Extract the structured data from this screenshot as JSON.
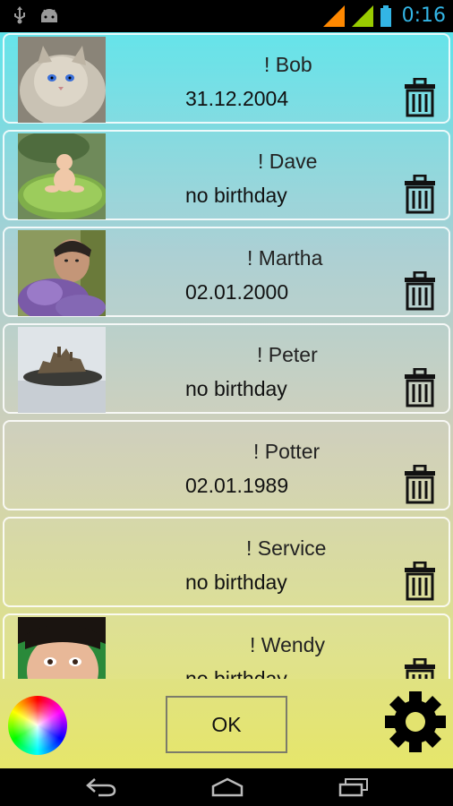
{
  "status": {
    "time": "0:16",
    "icons": [
      "usb-icon",
      "android-icon",
      "signal-orange-icon",
      "signal-green-icon",
      "battery-icon"
    ],
    "colors": {
      "time": "#33b5e5",
      "battery": "#33b5e5",
      "signal1": "#ff8800",
      "signal2": "#99cc00"
    }
  },
  "contacts": [
    {
      "name": "! Bob",
      "birthday": "31.12.2004",
      "photo": "kitten"
    },
    {
      "name": "! Dave",
      "birthday": "no birthday",
      "photo": "baby-on-leaf"
    },
    {
      "name": "! Martha",
      "birthday": "02.01.2000",
      "photo": "man-with-lavender"
    },
    {
      "name": "! Peter",
      "birthday": "no birthday",
      "photo": "castle-in-fog"
    },
    {
      "name": "! Potter",
      "birthday": "02.01.1989",
      "photo": ""
    },
    {
      "name": "! Service",
      "birthday": "no birthday",
      "photo": ""
    },
    {
      "name": "! Wendy",
      "birthday": "no birthday",
      "photo": "woman-face"
    }
  ],
  "bottom": {
    "ok_label": "OK"
  },
  "nav": {
    "icons": [
      "back-icon",
      "home-icon",
      "recent-apps-icon"
    ]
  }
}
